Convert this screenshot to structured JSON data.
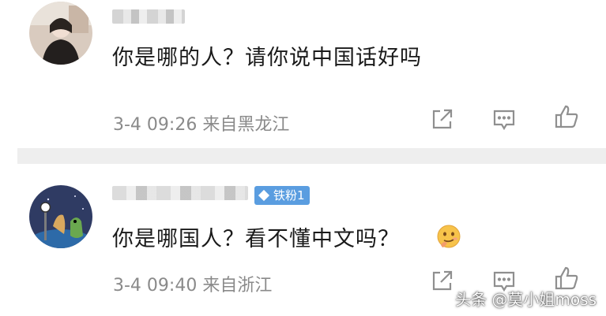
{
  "comments": [
    {
      "text": "你是哪的人？请你说中国话好吗",
      "meta": "3-4 09:26 来自黑龙江",
      "icons": [
        "share-icon",
        "reply-icon",
        "like-icon"
      ]
    },
    {
      "badge": "铁粉1",
      "text": "你是哪国人？看不懂中文吗？",
      "meta": "3-4 09:40 来自浙江",
      "icons": [
        "share-icon",
        "reply-icon",
        "like-icon"
      ],
      "emoji": "thinking-face-emoji"
    }
  ],
  "watermark": "头条 @莫小姐moss",
  "colors": {
    "text": "#1a1a1a",
    "meta": "#8a8a8a",
    "divider": "#eeeeee",
    "badge": "#5a9de0",
    "icon": "#8f8f8f"
  }
}
